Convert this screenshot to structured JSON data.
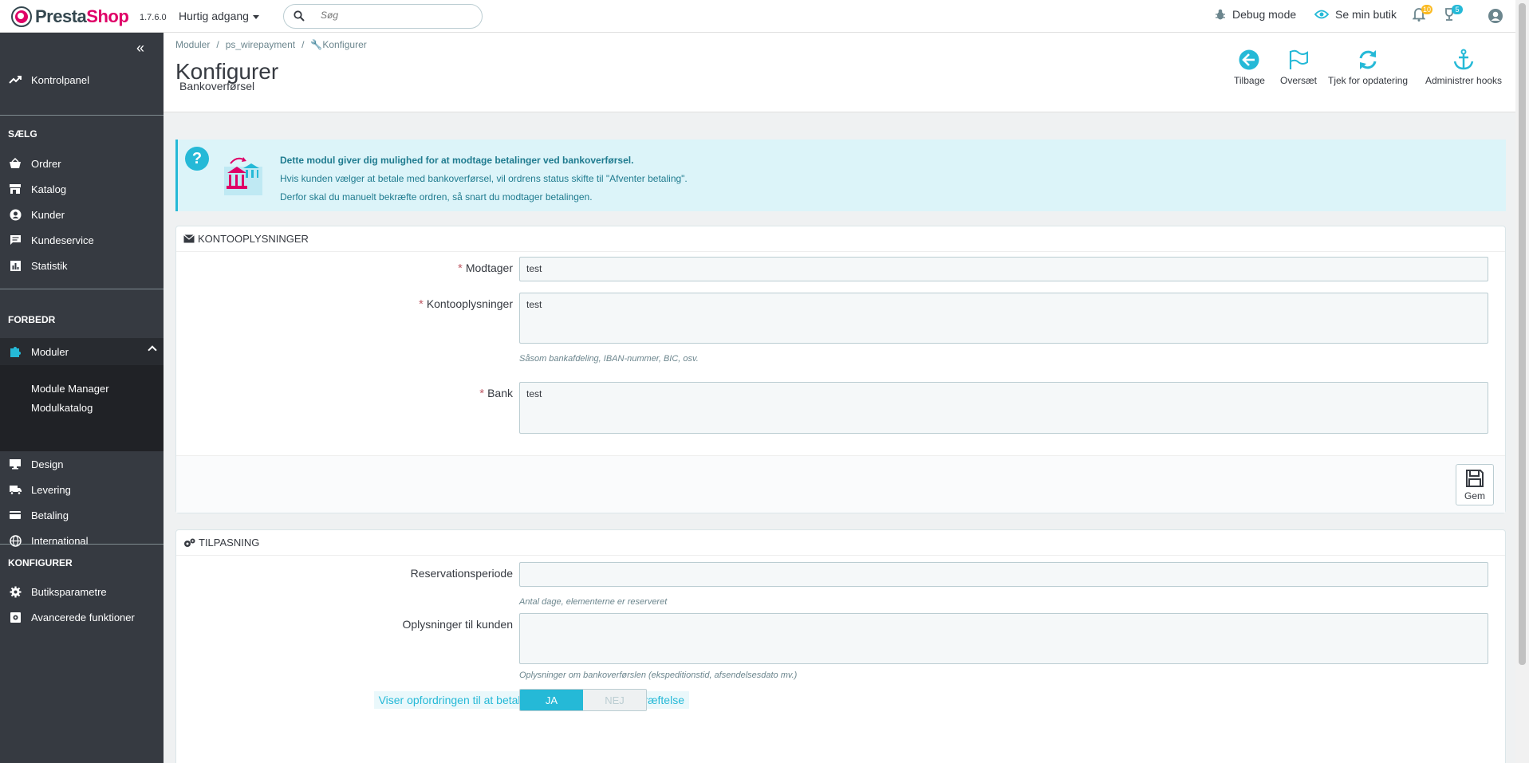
{
  "header": {
    "logo_brand_1": "Presta",
    "logo_brand_2": "Shop",
    "version": "1.7.6.0",
    "quick_access": "Hurtig adgang",
    "search_placeholder": "Søg",
    "debug_mode": "Debug mode",
    "view_shop": "Se min butik",
    "orders_badge": "10",
    "customers_badge": "5",
    "accent_color": "#25b9d7",
    "brand_color": "#df0067"
  },
  "sidebar": {
    "dashboard": "Kontrolpanel",
    "sections": {
      "sell": "SÆLG",
      "improve": "FORBEDR",
      "configure": "KONFIGURER"
    },
    "sell_items": [
      "Ordrer",
      "Katalog",
      "Kunder",
      "Kundeservice",
      "Statistik"
    ],
    "modules": "Moduler",
    "module_sub": [
      "Module Manager",
      "Modulkatalog"
    ],
    "improve_items": [
      "Design",
      "Levering",
      "Betaling",
      "International"
    ],
    "configure_items": [
      "Butiksparametre",
      "Avancerede funktioner"
    ]
  },
  "toolbar": {
    "breadcrumb": [
      "Moduler",
      "ps_wirepayment",
      "Konfigurer"
    ],
    "title": "Konfigurer",
    "subtitle": "Bankoverførsel",
    "buttons": [
      "Tilbage",
      "Oversæt",
      "Tjek for opdatering",
      "Administrer hooks"
    ]
  },
  "alert": {
    "line1": "Dette modul giver dig mulighed for at modtage betalinger ved bankoverførsel.",
    "line2": "Hvis kunden vælger at betale med bankoverførsel, vil ordrens status skifte til \"Afventer betaling\".",
    "line3": "Derfor skal du manuelt bekræfte ordren, så snart du modtager betalingen."
  },
  "account_panel": {
    "heading": "KONTOOPLYSNINGER",
    "recipient_label": "Modtager",
    "recipient_value": "test",
    "account_label": "Kontooplysninger",
    "account_value": "test",
    "account_help": "Såsom bankafdeling, IBAN-nummer, BIC, osv.",
    "bank_label": "Bank",
    "bank_value": "test",
    "save_label": "Gem"
  },
  "custom_panel": {
    "heading": "TILPASNING",
    "reservation_label": "Reservationsperiode",
    "reservation_value": "",
    "reservation_help": "Antal dage, elementerne er reserveret",
    "info_label": "Oplysninger til kunden",
    "info_value": "",
    "info_help": "Oplysninger om bankoverførslen (ekspeditionstid, afsendelsesdato mv.)",
    "toggle_label": "Viser opfordringen til at betale på siden med ordrebekræftelse",
    "toggle_yes": "JA",
    "toggle_no": "NEJ"
  }
}
